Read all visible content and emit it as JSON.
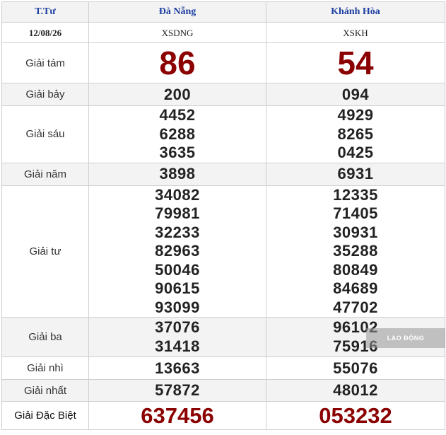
{
  "header": {
    "day": "T.Tư",
    "province1": "Đà Nẵng",
    "province2": "Khánh Hòa"
  },
  "subheader": {
    "date": "12/08/26",
    "code1": "XSDNG",
    "code2": "XSKH"
  },
  "prizes": {
    "g8": {
      "label": "Giải tám",
      "dn": "86",
      "kh": "54"
    },
    "g7": {
      "label": "Giải bảy",
      "dn": "200",
      "kh": "094"
    },
    "g6": {
      "label": "Giải sáu",
      "dn": [
        "4452",
        "6288",
        "3635"
      ],
      "kh": [
        "4929",
        "8265",
        "0425"
      ]
    },
    "g5": {
      "label": "Giải năm",
      "dn": "3898",
      "kh": "6931"
    },
    "g4": {
      "label": "Giải tư",
      "dn": [
        "34082",
        "79981",
        "32233",
        "82963",
        "50046",
        "90615",
        "93099"
      ],
      "kh": [
        "12335",
        "71405",
        "30931",
        "35288",
        "80849",
        "84689",
        "47702"
      ]
    },
    "g3": {
      "label": "Giải ba",
      "dn": [
        "37076",
        "31418"
      ],
      "kh": [
        "96102",
        "75916"
      ]
    },
    "g2": {
      "label": "Giải nhì",
      "dn": "13663",
      "kh": "55076"
    },
    "g1": {
      "label": "Giải nhất",
      "dn": "57872",
      "kh": "48012"
    },
    "db": {
      "label": "Giải Đặc Biệt",
      "dn": "637456",
      "kh": "053232"
    }
  },
  "watermark": "LAO ĐỘNG",
  "colors": {
    "header_text": "#1d3fa1",
    "special_number": "#8b0000",
    "border": "#cfcfcf",
    "alt_row": "#f3f3f3"
  }
}
